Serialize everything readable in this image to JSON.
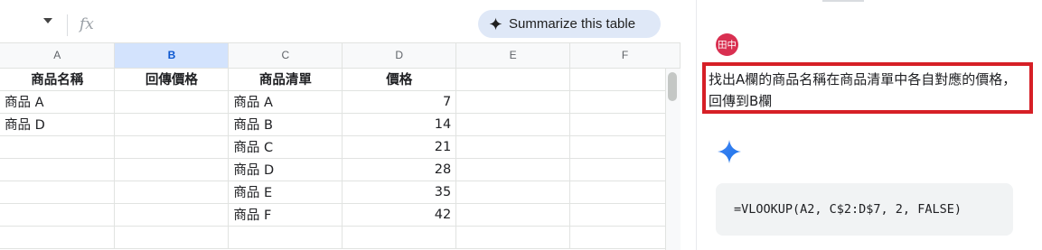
{
  "formula_bar": {
    "fx_label": "fx",
    "summarize_button_label": "Summarize this table"
  },
  "columns": [
    "A",
    "B",
    "C",
    "D",
    "E",
    "F"
  ],
  "selected_column": "B",
  "rows": [
    [
      "商品名稱",
      "回傳價格",
      "商品清單",
      "價格",
      "",
      ""
    ],
    [
      "商品 A",
      "",
      "商品 A",
      "7",
      "",
      ""
    ],
    [
      "商品 D",
      "",
      "商品 B",
      "14",
      "",
      ""
    ],
    [
      "",
      "",
      "商品 C",
      "21",
      "",
      ""
    ],
    [
      "",
      "",
      "商品 D",
      "28",
      "",
      ""
    ],
    [
      "",
      "",
      "商品 E",
      "35",
      "",
      ""
    ],
    [
      "",
      "",
      "商品 F",
      "42",
      "",
      ""
    ],
    [
      "",
      "",
      "",
      "",
      "",
      ""
    ]
  ],
  "side_panel": {
    "avatar_text": "田中",
    "prompt": "找出A欄的商品名稱在商品清單中各自對應的價格，回傳到B欄",
    "formula_response": "=VLOOKUP(A2, C$2:D$7, 2, FALSE)"
  },
  "colors": {
    "accent_blue": "#0b57d0",
    "highlight_red": "#d61f26",
    "avatar_red": "#d93051",
    "summarize_bg": "#dfe8f7"
  }
}
